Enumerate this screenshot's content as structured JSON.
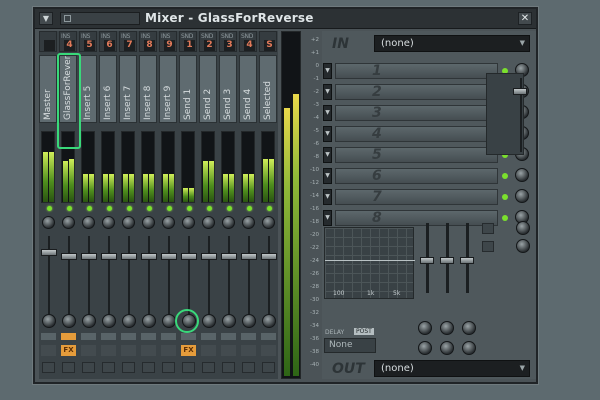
{
  "window": {
    "title": "Mixer - GlassForReverse",
    "menu_icon": "dropdown-arrow-icon",
    "close_icon": "close-icon"
  },
  "strips": [
    {
      "name": "Master",
      "header_label": "",
      "header_value": "",
      "fx": false,
      "route": false,
      "led": true
    },
    {
      "name": "GlassForReverse",
      "header_label": "INS",
      "header_value": "4",
      "fx": true,
      "route": true,
      "led": true
    },
    {
      "name": "Insert 5",
      "header_label": "INS",
      "header_value": "5",
      "fx": false,
      "route": false,
      "led": true
    },
    {
      "name": "Insert 6",
      "header_label": "INS",
      "header_value": "6",
      "fx": false,
      "route": false,
      "led": true
    },
    {
      "name": "Insert 7",
      "header_label": "INS",
      "header_value": "7",
      "fx": false,
      "route": false,
      "led": true
    },
    {
      "name": "Insert 8",
      "header_label": "INS",
      "header_value": "8",
      "fx": false,
      "route": false,
      "led": true
    },
    {
      "name": "Insert 9",
      "header_label": "INS",
      "header_value": "9",
      "fx": false,
      "route": false,
      "led": true
    },
    {
      "name": "Send 1",
      "header_label": "SND",
      "header_value": "1",
      "fx": true,
      "route": false,
      "led": true
    },
    {
      "name": "Send 2",
      "header_label": "SND",
      "header_value": "2",
      "fx": false,
      "route": false,
      "led": true
    },
    {
      "name": "Send 3",
      "header_label": "SND",
      "header_value": "3",
      "fx": false,
      "route": false,
      "led": true
    },
    {
      "name": "Send 4",
      "header_label": "SND",
      "header_value": "4",
      "fx": false,
      "route": false,
      "led": true
    },
    {
      "name": "Selected",
      "header_label": "",
      "header_value": "S",
      "fx": false,
      "route": false,
      "led": true
    }
  ],
  "fx_label": "FX",
  "scale_ticks": [
    "+2",
    "+1",
    "0",
    "-1",
    "-2",
    "-3",
    "-4",
    "-5",
    "-6",
    "-8",
    "-10",
    "-12",
    "-14",
    "-16",
    "-18",
    "-20",
    "-22",
    "-24",
    "-26",
    "-28",
    "-30",
    "-32",
    "-34",
    "-36",
    "-38",
    "-40"
  ],
  "right_panel": {
    "in_label": "IN",
    "in_value": "(none)",
    "slots": [
      "1",
      "2",
      "3",
      "4",
      "5",
      "6",
      "7",
      "8"
    ],
    "eq_freqs": [
      "100",
      "1k",
      "5k"
    ],
    "delay_label": "DELAY",
    "post_label": "POST",
    "delay_value": "None",
    "out_label": "OUT",
    "out_value": "(none)"
  }
}
